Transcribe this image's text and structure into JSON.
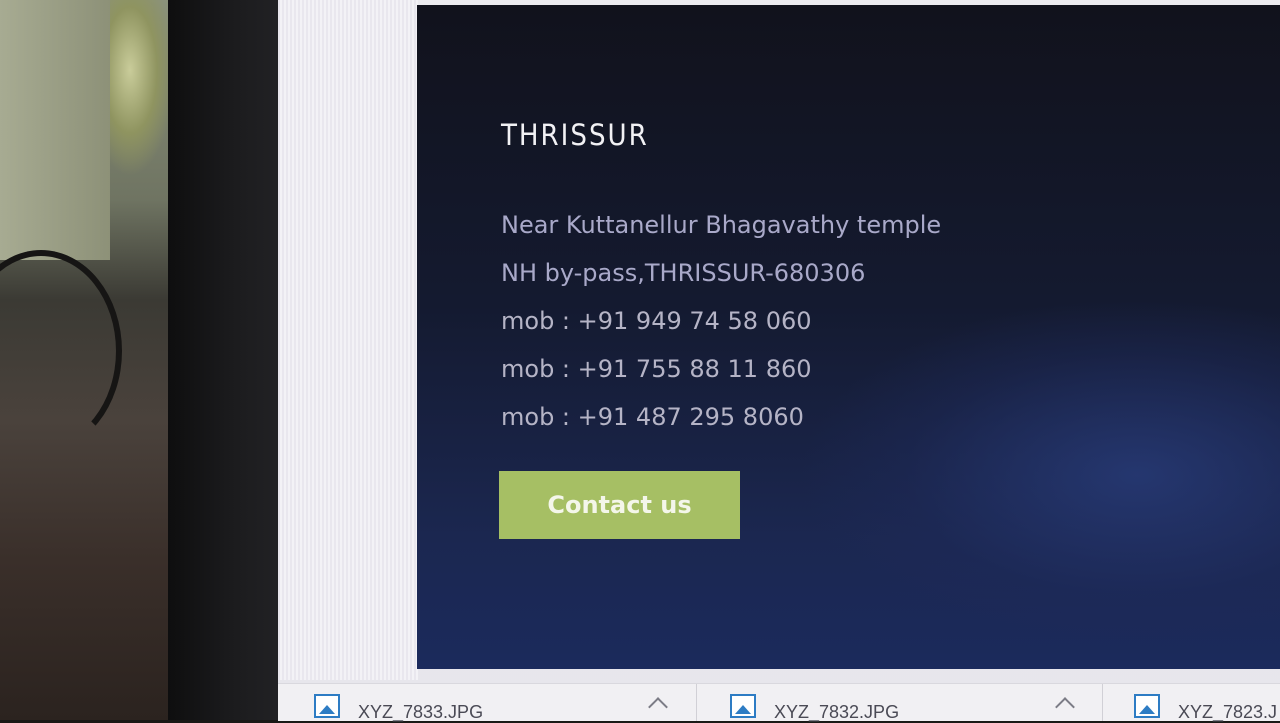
{
  "section": {
    "title": "THRISSUR",
    "address_line_1": "Near Kuttanellur Bhagavathy temple",
    "address_line_2": "NH by-pass,THRISSUR-680306",
    "phones": [
      "mob : +91 949 74 58 060",
      "mob : +91 755 88 11 860",
      "mob : +91 487 295 8060"
    ],
    "contact_button_label": "Contact us"
  },
  "downloads": [
    {
      "name": "XYZ_7833.JPG",
      "icon": "image-file-icon"
    },
    {
      "name": "XYZ_7832.JPG",
      "icon": "image-file-icon"
    },
    {
      "name": "XYZ_7823.J",
      "icon": "image-file-icon"
    }
  ],
  "colors": {
    "panel_background": "#141a30",
    "button_accent": "#a6bf64",
    "title_text": "#f1f1f4",
    "body_text": "#a9a9c9"
  }
}
